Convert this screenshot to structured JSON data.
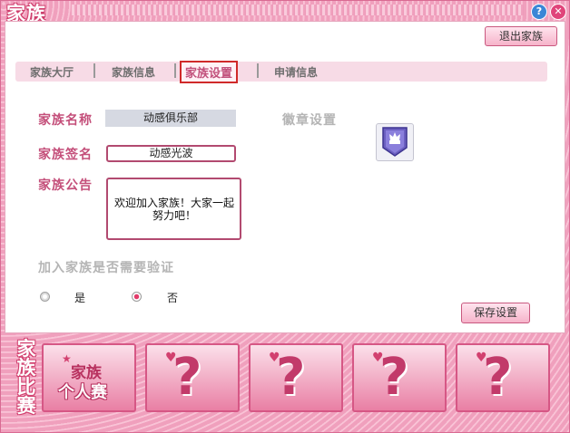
{
  "window": {
    "title": "家族",
    "help_glyph": "?",
    "close_glyph": "✕"
  },
  "header": {
    "exit_label": "退出家族"
  },
  "tabs": [
    {
      "label": "家族大厅",
      "active": false
    },
    {
      "label": "家族信息",
      "active": false
    },
    {
      "label": "家族设置",
      "active": true
    },
    {
      "label": "申请信息",
      "active": false
    }
  ],
  "form": {
    "name_label": "家族名称",
    "name_value": "动感俱乐部",
    "sign_label": "家族签名",
    "sign_value": "动感光波",
    "notice_label": "家族公告",
    "notice_value": "欢迎加入家族！大家一起努力吧！",
    "badge_label": "徽章设置",
    "badge_icon": "chess-king-shield-icon"
  },
  "verify": {
    "label": "加入家族是否需要验证",
    "options": [
      {
        "label": "是",
        "selected": false
      },
      {
        "label": "否",
        "selected": true
      }
    ]
  },
  "save_label": "保存设置",
  "competition": {
    "vertical_title": [
      "家",
      "族",
      "比",
      "赛"
    ],
    "cards": [
      {
        "line1": "家族",
        "line2": "个人赛",
        "locked": false
      },
      {
        "glyph": "?",
        "locked": true
      },
      {
        "glyph": "?",
        "locked": true
      },
      {
        "glyph": "?",
        "locked": true
      },
      {
        "glyph": "?",
        "locked": true
      }
    ]
  },
  "colors": {
    "accent": "#c44f7a",
    "border": "#b24a70",
    "tab_highlight": "#d02a2a"
  }
}
